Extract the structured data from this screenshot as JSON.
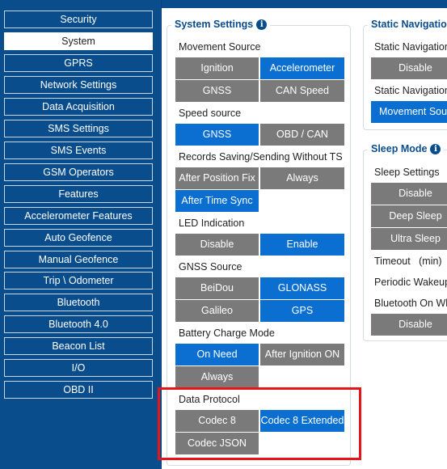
{
  "sidebar": {
    "items": [
      {
        "label": "Security",
        "active": false
      },
      {
        "label": "System",
        "active": true
      },
      {
        "label": "GPRS",
        "active": false
      },
      {
        "label": "Network Settings",
        "active": false
      },
      {
        "label": "Data Acquisition",
        "active": false
      },
      {
        "label": "SMS Settings",
        "active": false
      },
      {
        "label": "SMS Events",
        "active": false
      },
      {
        "label": "GSM Operators",
        "active": false
      },
      {
        "label": "Features",
        "active": false
      },
      {
        "label": "Accelerometer Features",
        "active": false
      },
      {
        "label": "Auto Geofence",
        "active": false
      },
      {
        "label": "Manual Geofence",
        "active": false
      },
      {
        "label": "Trip \\ Odometer",
        "active": false
      },
      {
        "label": "Bluetooth",
        "active": false
      },
      {
        "label": "Bluetooth 4.0",
        "active": false
      },
      {
        "label": "Beacon List",
        "active": false
      },
      {
        "label": "I/O",
        "active": false
      },
      {
        "label": "OBD II",
        "active": false
      }
    ]
  },
  "system_settings": {
    "title": "System Settings",
    "info_icon": "i",
    "movement_source": {
      "label": "Movement Source",
      "ignition": "Ignition",
      "accelerometer": "Accelerometer",
      "gnss": "GNSS",
      "can_speed": "CAN Speed"
    },
    "speed_source": {
      "label": "Speed source",
      "gnss": "GNSS",
      "obd_can": "OBD / CAN"
    },
    "records_saving": {
      "label": "Records Saving/Sending Without TS",
      "after_position_fix": "After Position Fix",
      "always": "Always",
      "after_time_sync": "After Time Sync"
    },
    "led_indication": {
      "label": "LED Indication",
      "disable": "Disable",
      "enable": "Enable"
    },
    "gnss_source": {
      "label": "GNSS Source",
      "beidou": "BeiDou",
      "glonass": "GLONASS",
      "galileo": "Galileo",
      "gps": "GPS"
    },
    "battery_charge_mode": {
      "label": "Battery Charge Mode",
      "on_need": "On Need",
      "after_ignition_on": "After Ignition ON",
      "always": "Always"
    },
    "data_protocol": {
      "label": "Data Protocol",
      "codec8": "Codec 8",
      "codec8_extended": "Codec 8 Extended",
      "codec_json": "Codec JSON"
    }
  },
  "static_navigation": {
    "title": "Static Navigation",
    "row1_label": "Static Navigation",
    "disable": "Disable",
    "row2_label": "Static Navigation",
    "movement_source": "Movement Sour"
  },
  "sleep_mode": {
    "title": "Sleep Mode",
    "info_icon": "i",
    "settings_label": "Sleep Settings",
    "disable": "Disable",
    "deep_sleep": "Deep Sleep",
    "ultra_sleep": "Ultra Sleep",
    "timeout_label": "Timeout",
    "timeout_unit": "(min)",
    "periodic_wakeup_label": "Periodic Wakeup",
    "bluetooth_on_label": "Bluetooth On Wh",
    "bluetooth_disable": "Disable"
  },
  "colors": {
    "sidebar": "#0a4d8c",
    "selected": "#0a6fd0",
    "unselected": "#7a7a7a",
    "highlight": "#e8141b"
  }
}
